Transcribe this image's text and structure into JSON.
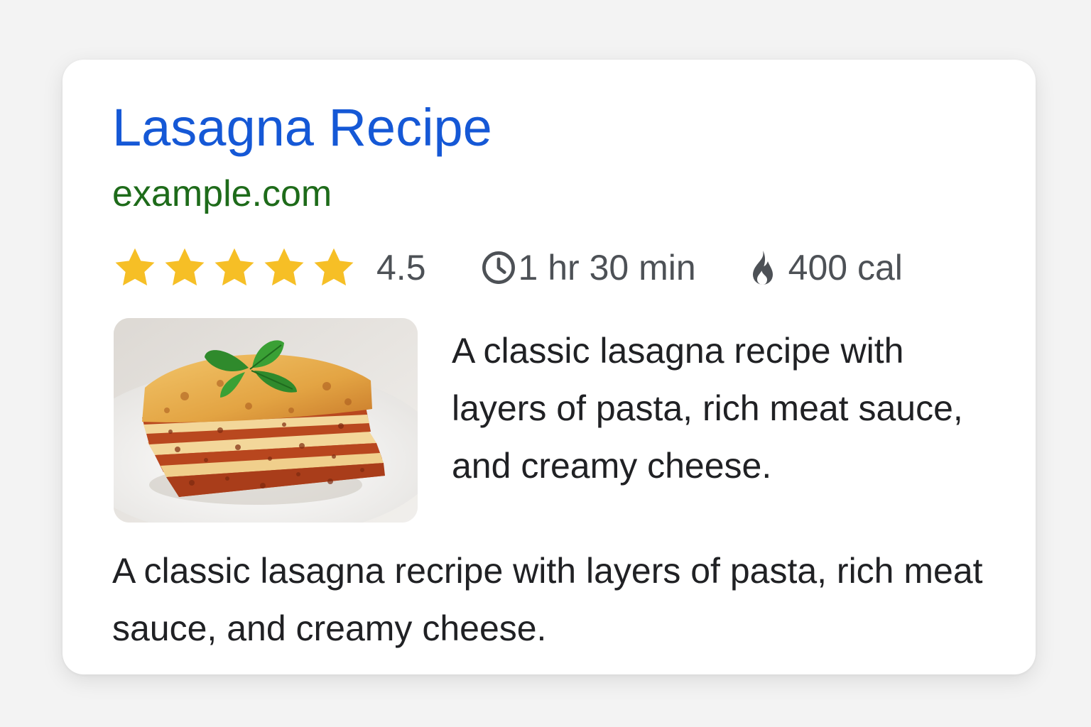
{
  "result": {
    "title": "Lasagna Recipe",
    "site": "example.com",
    "rating": {
      "value": "4.5",
      "stars_filled": 5,
      "stars_total": 5,
      "star_color": "#f6bf26"
    },
    "time": {
      "icon": "clock-icon",
      "text": "1 hr 30 min"
    },
    "calories": {
      "icon": "flame-icon",
      "text": "400 cal"
    },
    "image": {
      "subject": "lasagna-photo"
    },
    "description_side": "A classic lasagna recipe with layers of pasta, rich meat sauce, and creamy cheese.",
    "description_bottom": "A classic lasagna recripe with layers of pasta, rich meat sauce, and creamy cheese."
  },
  "colors": {
    "title": "#1558d6",
    "site": "#1e6b1a",
    "meta_text": "#4d5156",
    "body_text": "#202124",
    "card_bg": "#ffffff",
    "page_bg": "#f3f3f3"
  }
}
